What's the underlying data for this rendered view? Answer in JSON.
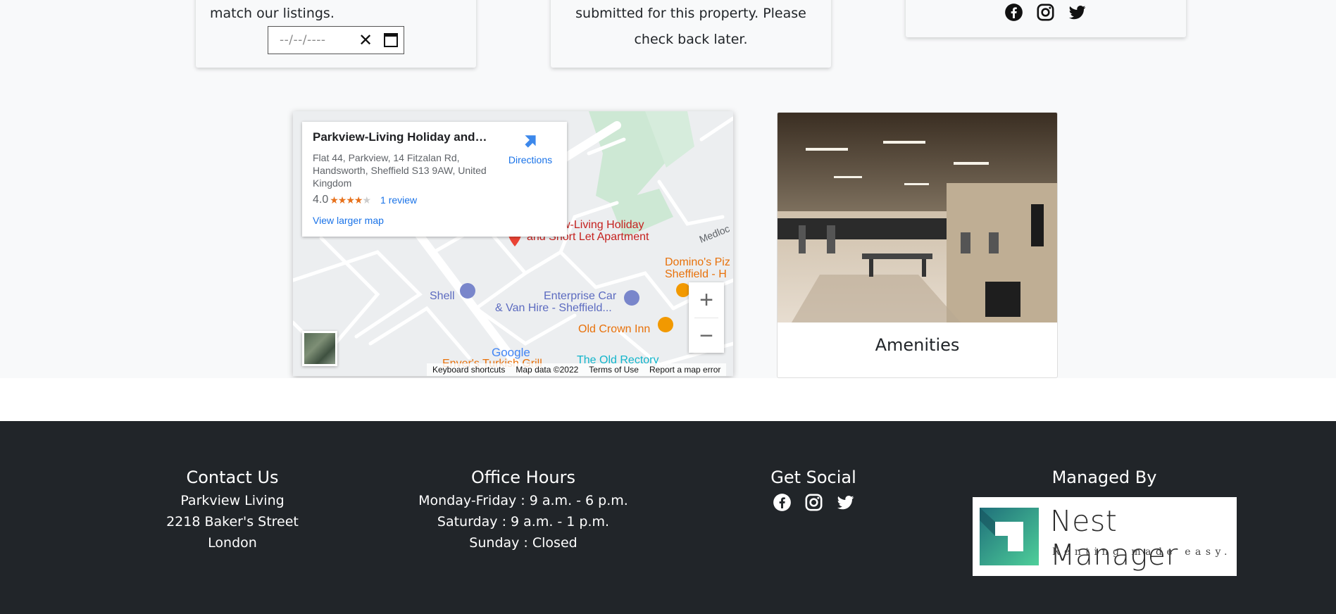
{
  "cards": {
    "availability_text": "match our listings.",
    "date_placeholder": "--/--/----",
    "reviews_text_line1": "submitted for this property. Please",
    "reviews_text_line2": "check back later."
  },
  "map": {
    "place_title": "Parkview-Living Holiday and S...",
    "address": "Flat 44, Parkview, 14 Fitzalan Rd, Handsworth, Sheffield S13 9AW, United Kingdom",
    "rating": "4.0",
    "stars": 4,
    "reviews_link": "1 review",
    "larger_map_link": "View larger map",
    "directions_label": "Directions",
    "pin_label_line1": "w-Living Holiday",
    "pin_label_line2": "and Short Let Apartment",
    "labels": {
      "shell": "Shell",
      "enterprise_line1": "Enterprise Car",
      "enterprise_line2": "& Van Hire - Sheffield...",
      "old_crown": "Old Crown Inn",
      "dominos_line1": "Domino's Piz",
      "dominos_line2": "Sheffield - H",
      "old_rectory": "The Old Rectory",
      "enver": "Enver's Turkish Grill",
      "medlock": "Medloc"
    },
    "google": "Google",
    "footer": {
      "shortcuts": "Keyboard shortcuts",
      "data": "Map data ©2022",
      "terms": "Terms of Use",
      "report": "Report a map error"
    }
  },
  "amenities": {
    "title": "Amenities"
  },
  "footer": {
    "contact": {
      "heading": "Contact Us",
      "line1": "Parkview Living",
      "line2": "2218 Baker's Street",
      "line3": "London"
    },
    "hours": {
      "heading": "Office Hours",
      "line1": "Monday-Friday : 9 a.m. - 6 p.m.",
      "line2": "Saturday : 9 a.m. - 1 p.m.",
      "line3": "Sunday : Closed"
    },
    "social": {
      "heading": "Get Social"
    },
    "managed": {
      "heading": "Managed By",
      "logo_name": "Nest Manager",
      "logo_tag": "Renting made easy."
    }
  },
  "icons": [
    "facebook-icon",
    "instagram-icon",
    "twitter-icon",
    "date-clear-icon",
    "calendar-icon",
    "directions-icon",
    "map-pin-icon",
    "zoom-in-icon",
    "zoom-out-icon"
  ],
  "colors": {
    "footer_bg": "#212529",
    "page_bg": "#f8f9fa",
    "link_blue": "#1a73e8",
    "map_pin": "#ea4335",
    "poi_orange": "#e8710a"
  }
}
